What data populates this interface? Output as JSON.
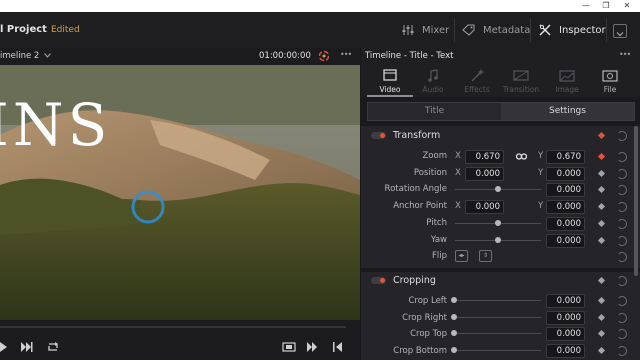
{
  "window": {
    "minimize": "—",
    "restore": "❐",
    "close": "✕"
  },
  "topbar": {
    "project_name": "l Project",
    "status": "Edited",
    "mixer_label": "Mixer",
    "metadata_label": "Metadata",
    "inspector_label": "Inspector"
  },
  "viewer": {
    "timeline_name": "imeline 2",
    "timecode": "01:00:00:00",
    "more": "•••",
    "overlay_text": "INS"
  },
  "inspector": {
    "title": "Timeline - Title - Text",
    "more": "•••",
    "tabs": [
      {
        "label": "Video",
        "icon": "video-icon",
        "active": true
      },
      {
        "label": "Audio",
        "icon": "audio-icon",
        "active": false
      },
      {
        "label": "Effects",
        "icon": "effects-icon",
        "active": false
      },
      {
        "label": "Transition",
        "icon": "transition-icon",
        "active": false
      },
      {
        "label": "Image",
        "icon": "image-icon",
        "active": false
      },
      {
        "label": "File",
        "icon": "file-icon",
        "active": false
      }
    ],
    "subtabs": {
      "title": "Title",
      "settings": "Settings"
    },
    "transform": {
      "heading": "Transform",
      "zoom": {
        "label": "Zoom",
        "x_axis": "X",
        "x": "0.670",
        "y_axis": "Y",
        "y": "0.670"
      },
      "position": {
        "label": "Position",
        "x_axis": "X",
        "x": "0.000",
        "y_axis": "Y",
        "y": "0.000"
      },
      "rotation": {
        "label": "Rotation Angle",
        "value": "0.000",
        "level": 0.5
      },
      "anchor": {
        "label": "Anchor Point",
        "x_axis": "X",
        "x": "0.000",
        "y_axis": "Y",
        "y": "0.000"
      },
      "pitch": {
        "label": "Pitch",
        "value": "0.000",
        "level": 0.5
      },
      "yaw": {
        "label": "Yaw",
        "value": "0.000",
        "level": 0.5
      },
      "flip": {
        "label": "Flip"
      }
    },
    "cropping": {
      "heading": "Cropping",
      "left": {
        "label": "Crop Left",
        "value": "0.000"
      },
      "right": {
        "label": "Crop Right",
        "value": "0.000"
      },
      "top": {
        "label": "Crop Top",
        "value": "0.000"
      },
      "bottom": {
        "label": "Crop Bottom",
        "value": "0.000"
      }
    }
  },
  "colors": {
    "accent_red": "#e4523b",
    "edited_yellow": "#d2a43a",
    "panel": "#252529"
  }
}
